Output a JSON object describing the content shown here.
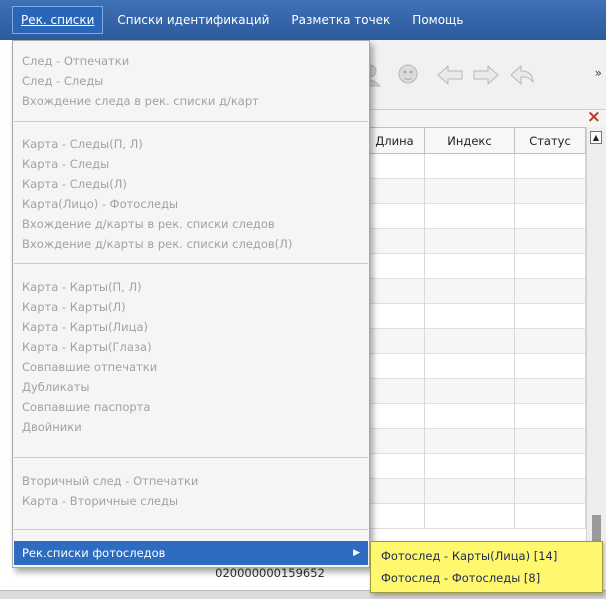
{
  "menubar": {
    "items": [
      {
        "label": "Рек. списки"
      },
      {
        "label": "Списки идентификаций"
      },
      {
        "label": "Разметка точек"
      },
      {
        "label": "Помощь"
      }
    ]
  },
  "toolbar": {
    "icons": [
      "person-search-icon",
      "face-search-icon",
      "arrow-left-icon",
      "arrow-right-icon",
      "arrow-back-icon"
    ],
    "overflow_label": "»"
  },
  "closebar": {
    "close_label": "×"
  },
  "table": {
    "columns": [
      "Длина",
      "Индекс",
      "Статус"
    ],
    "scroll_up_label": "▲",
    "bottom_value": "020000000159652"
  },
  "dropdown": {
    "groups": [
      [
        "След - Отпечатки",
        "След - Следы",
        "Вхождение следа в рек. списки д/карт"
      ],
      [
        "Карта - Следы(П, Л)",
        "Карта - Следы",
        "Карта - Следы(Л)",
        "Карта(Лицо) - Фотоследы",
        "Вхождение д/карты в рек. списки следов",
        "Вхождение д/карты в рек. списки следов(Л)"
      ],
      [
        "Карта - Карты(П, Л)",
        "Карта - Карты(Л)",
        "Карта - Карты(Лица)",
        "Карта - Карты(Глаза)",
        "Совпавшие отпечатки",
        "Дубликаты",
        "Совпавшие паспорта",
        "Двойники"
      ],
      [
        "Вторичный след - Отпечатки",
        "Карта - Вторичные следы"
      ]
    ],
    "active_item": "Рек.списки фотоследов",
    "active_arrow": "▶"
  },
  "submenu": {
    "items": [
      {
        "label": "Фотослед - Карты(Лица)  [14]"
      },
      {
        "label": "Фотослед - Фотоследы  [8]"
      }
    ]
  },
  "colors": {
    "menubar": "#2d5a9c",
    "highlight": "#2d6cc0",
    "submenu_bg": "#fff86e",
    "disabled_text": "#a2a2a2"
  }
}
